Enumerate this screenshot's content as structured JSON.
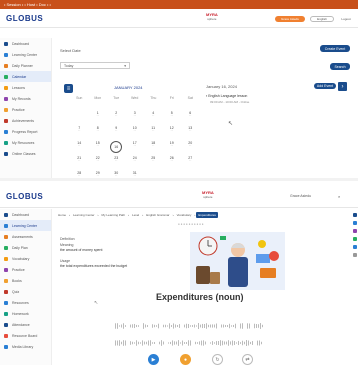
{
  "browser_bar": {
    "text": "• Session • • Host • Doc • •"
  },
  "top_header": {
    "logo": "GLOBUS",
    "brand_name": "MYRA",
    "brand_sub": "sphere",
    "user_pill": "Grace Asiedu",
    "lang_select": "English",
    "signout": "Logout"
  },
  "top_sidebar": [
    {
      "label": "Dashboard"
    },
    {
      "label": "Learning Center"
    },
    {
      "label": "Daily Planner"
    },
    {
      "label": "Calendar"
    },
    {
      "label": "Lessons"
    },
    {
      "label": "My Records"
    },
    {
      "label": "Practice"
    },
    {
      "label": "Achievements"
    },
    {
      "label": "Progress Report"
    },
    {
      "label": "My Resources"
    },
    {
      "label": "Online Classes"
    }
  ],
  "calendar_page": {
    "label": "Select Date",
    "select_value": "Today",
    "create_button": "Create Event",
    "go_button": "Search",
    "month_title": "JANUARY 2024",
    "weekdays": [
      "Sun",
      "Mon",
      "Tue",
      "Wed",
      "Thu",
      "Fri",
      "Sat"
    ],
    "weeks": [
      [
        "",
        "1",
        "2",
        "3",
        "4",
        "5",
        "6"
      ],
      [
        "7",
        "8",
        "9",
        "10",
        "11",
        "12",
        "13"
      ],
      [
        "14",
        "15",
        "16",
        "17",
        "18",
        "19",
        "20"
      ],
      [
        "21",
        "22",
        "23",
        "24",
        "25",
        "26",
        "27"
      ],
      [
        "28",
        "29",
        "30",
        "31",
        "",
        "",
        ""
      ]
    ],
    "today": "16",
    "events_date": "January 16, 2024",
    "events_button": "Add Event",
    "event_title": "English Language lesson",
    "event_time": "09:00 AM - 10:00 AM - Online"
  },
  "bottom_header": {
    "logo": "GLOBUS",
    "brand_name": "MYRA",
    "brand_sub": "sphere",
    "user_label": "Grace Asiedu"
  },
  "bottom_sidebar": [
    {
      "label": "Dashboard"
    },
    {
      "label": "Learning Center"
    },
    {
      "label": "Assessments"
    },
    {
      "label": "Daily Plan"
    },
    {
      "label": "Vocabulary"
    },
    {
      "label": "Practice"
    },
    {
      "label": "Books"
    },
    {
      "label": "Quiz"
    },
    {
      "label": "Resources"
    },
    {
      "label": "Homework"
    },
    {
      "label": "Attendance"
    },
    {
      "label": "Resource Board"
    },
    {
      "label": "Media Library"
    }
  ],
  "breadcrumb": [
    "Home",
    "Learning Center",
    "My Learning Path",
    "Level",
    "English Grammar",
    "Vocabulary",
    "Expenditures"
  ],
  "word_page": {
    "section_label": "Definition",
    "meaning_label": "Meaning",
    "meaning_value": "the amount of money spent",
    "usage_label": "Usage",
    "usage_value": "the total expenditures exceeded the budget",
    "word": "Expenditures (noun)"
  },
  "colors": {
    "accent_blue": "#1a4c8c",
    "topbar_orange": "#c8501a",
    "play_blue": "#2a7fd4",
    "mic_orange": "#f0a030"
  }
}
